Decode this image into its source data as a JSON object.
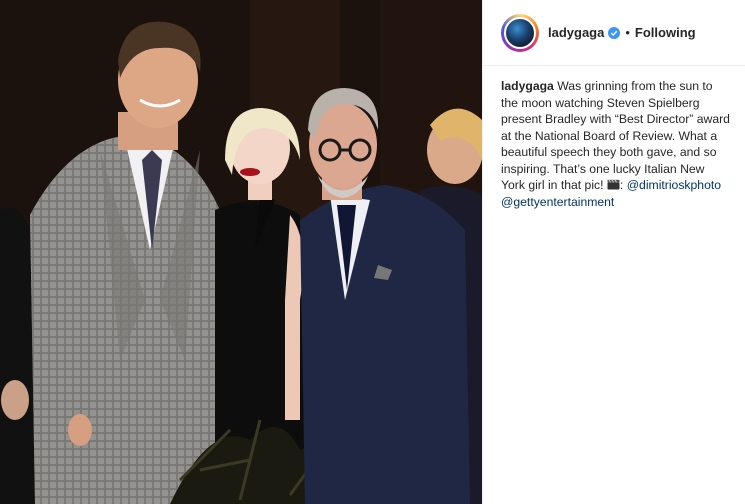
{
  "post": {
    "username": "ladygaga",
    "follow_state": "Following",
    "separator": "•",
    "caption": {
      "user": "ladygaga",
      "text": "Was grinning from the sun to the moon watching Steven Spielberg present Bradley with “Best Director” award at the National Board of Review. What a beautiful speech they both gave, and so inspiring. That’s one lucky Italian New York girl in that pic!",
      "credit_prefix": ":",
      "mention_1": "@dimitrioskphoto",
      "mention_2": "@gettyentertainment"
    }
  },
  "colors": {
    "verified_badge": "#3897f0",
    "mention": "#003569",
    "text": "#262626",
    "divider": "#efefef"
  },
  "icons": {
    "verified": "verified-badge-icon",
    "credit": "clapperboard-icon"
  }
}
